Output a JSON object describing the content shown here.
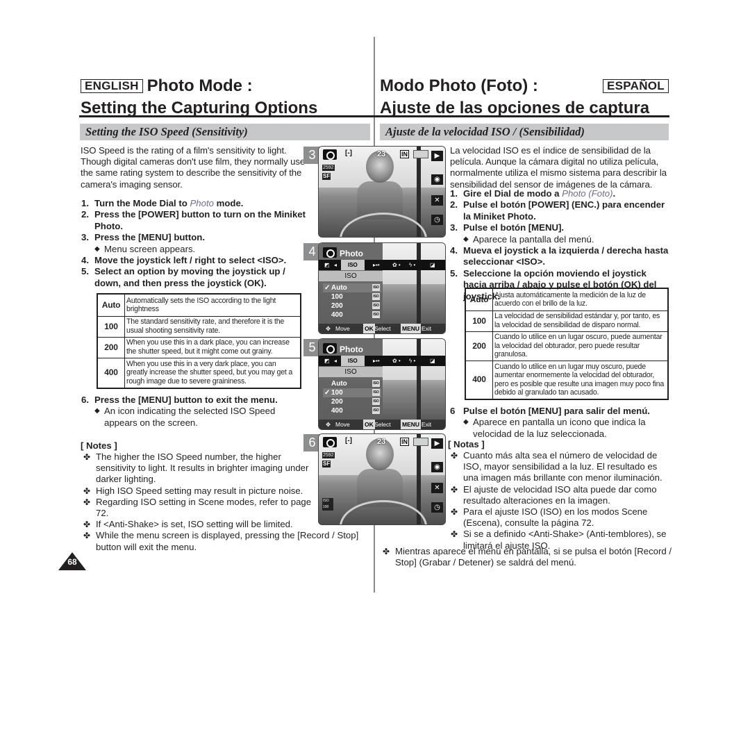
{
  "english": {
    "lang_badge": "ENGLISH",
    "title_line1": "Photo Mode :",
    "title_line2": "Setting the Capturing Options",
    "section": "Setting the ISO Speed (Sensitivity)",
    "intro": "ISO Speed is the rating of a film's sensitivity to light. Though digital cameras don't use film, they normally use the same rating system to describe the sensitivity of the camera's imaging sensor.",
    "steps": [
      {
        "num": "1.",
        "pre": "Turn the Mode Dial to ",
        "mode": "Photo",
        "post": " mode."
      },
      {
        "num": "2.",
        "text": "Press the [POWER] button to turn on the Miniket Photo."
      },
      {
        "num": "3.",
        "text": "Press the [MENU] button.",
        "sub": "Menu screen appears."
      },
      {
        "num": "4.",
        "text": "Move the joystick left / right to select <ISO>."
      },
      {
        "num": "5.",
        "text": "Select an option by moving the joystick up / down, and then press the joystick (OK)."
      },
      {
        "num": "6.",
        "text": "Press the [MENU] button to exit the menu.",
        "sub": "An icon indicating the selected ISO Speed appears on the screen."
      }
    ],
    "table": [
      {
        "key": "Auto",
        "desc": "Automatically sets the ISO according to the light brightness"
      },
      {
        "key": "100",
        "desc": "The standard sensitivity rate, and therefore it is the usual shooting sensitivity rate."
      },
      {
        "key": "200",
        "desc": "When you use this in a dark place, you can increase the shutter speed, but it might come out grainy."
      },
      {
        "key": "400",
        "desc": "When you use this in a very dark place, you can greatly increase the shutter speed, but you may get a rough image due to severe graininess."
      }
    ],
    "notes_heading": "[ Notes ]",
    "notes": [
      "The higher the ISO Speed number, the higher sensitivity to light. It results in brighter imaging under darker lighting.",
      "High ISO Speed setting may result in picture noise.",
      "Regarding ISO setting in Scene modes, refer to page 72.",
      "If <Anti-Shake> is set, ISO setting will be limited.",
      "While the menu screen is displayed, pressing the [Record / Stop] button will exit the menu."
    ],
    "page_number": "68"
  },
  "spanish": {
    "lang_badge": "ESPAÑOL",
    "title_line1": "Modo Photo (Foto) :",
    "title_line2": "Ajuste de las opciones de captura",
    "section": "Ajuste de la velocidad ISO / (Sensibilidad)",
    "intro": "La velocidad ISO es el índice de sensibilidad de la película. Aunque la cámara digital no utiliza película, normalmente utiliza el mismo sistema para describir la sensibilidad del sensor de imágenes de la cámara.",
    "steps": [
      {
        "num": "1.",
        "pre": "Gire el Dial de modo a ",
        "mode": "Photo (Foto)",
        "post": "."
      },
      {
        "num": "2.",
        "text": "Pulse el botón [POWER] (ENC.) para encender la Miniket Photo."
      },
      {
        "num": "3.",
        "text": "Pulse el botón [MENU].",
        "sub": "Aparece la pantalla del menú."
      },
      {
        "num": "4.",
        "text": "Mueva el joystick a la izquierda / derecha hasta seleccionar <ISO>."
      },
      {
        "num": "5.",
        "text": "Seleccione la opción moviendo el joystick hacia arriba / abajo y pulse el botón (OK) del joystick."
      },
      {
        "num": "6",
        "text": "Pulse el botón [MENU] para salir del menú.",
        "sub": "Aparece en pantalla un icono que indica la velocidad de la luz seleccionada."
      }
    ],
    "table": [
      {
        "key": "Auto",
        "desc": "Ajusta automáticamente la medición de la luz de acuerdo con el brillo de la luz."
      },
      {
        "key": "100",
        "desc": "La velocidad de sensibilidad estándar y, por tanto, es la velocidad de sensibilidad de disparo normal."
      },
      {
        "key": "200",
        "desc": "Cuando lo utilice en un lugar oscuro, puede aumentar la velocidad del obturador, pero puede resultar granulosa."
      },
      {
        "key": "400",
        "desc": "Cuando lo utilice en un lugar muy oscuro, puede aumentar enormemente la velocidad del obturador, pero es posible que resulte una imagen muy poco fina debido al granulado tan acusado."
      }
    ],
    "notes_heading": "[ Notas ]",
    "notes": [
      "Cuanto más alta sea el número de velocidad de ISO, mayor sensibilidad a la luz. El resultado es una imagen más brillante con menor iluminación.",
      "El ajuste de velocidad ISO alta puede dar como resultado alteraciones en la imagen.",
      "Para el ajuste ISO (ISO) en los modos Scene (Escena), consulte la página 72.",
      "Si se a definido <Anti-Shake> (Anti-temblores), se limitará el ajuste ISO.",
      "Mientras aparece el menú en pantalla, si se pulsa el botón [Record / Stop] (Grabar / Detener) se saldrá del menú."
    ]
  },
  "screens": {
    "s3": {
      "step": "3",
      "shots": "23",
      "mem": "IN",
      "res": "2592",
      "sf": "SF"
    },
    "s4": {
      "step": "4",
      "head": "Photo",
      "tab": "ISO",
      "title": "ISO",
      "options": [
        "Auto",
        "100",
        "200",
        "400"
      ],
      "selected": "Auto",
      "check": "✓",
      "foot_move": "Move",
      "foot_ok": "OK",
      "foot_select": "Select",
      "foot_menu": "MENU",
      "foot_exit": "Exit"
    },
    "s5": {
      "step": "5",
      "head": "Photo",
      "tab": "ISO",
      "title": "ISO",
      "options": [
        "Auto",
        "100",
        "200",
        "400"
      ],
      "selected": "100",
      "check": "✓",
      "foot_move": "Move",
      "foot_ok": "OK",
      "foot_select": "Select",
      "foot_menu": "MENU",
      "foot_exit": "Exit"
    },
    "s6": {
      "step": "6",
      "shots": "23",
      "mem": "IN",
      "res": "2592",
      "sf": "SF",
      "iso_badge": "ISO 100"
    }
  },
  "icons": {
    "note_bullet": "✤",
    "sub_bullet": "◆"
  }
}
